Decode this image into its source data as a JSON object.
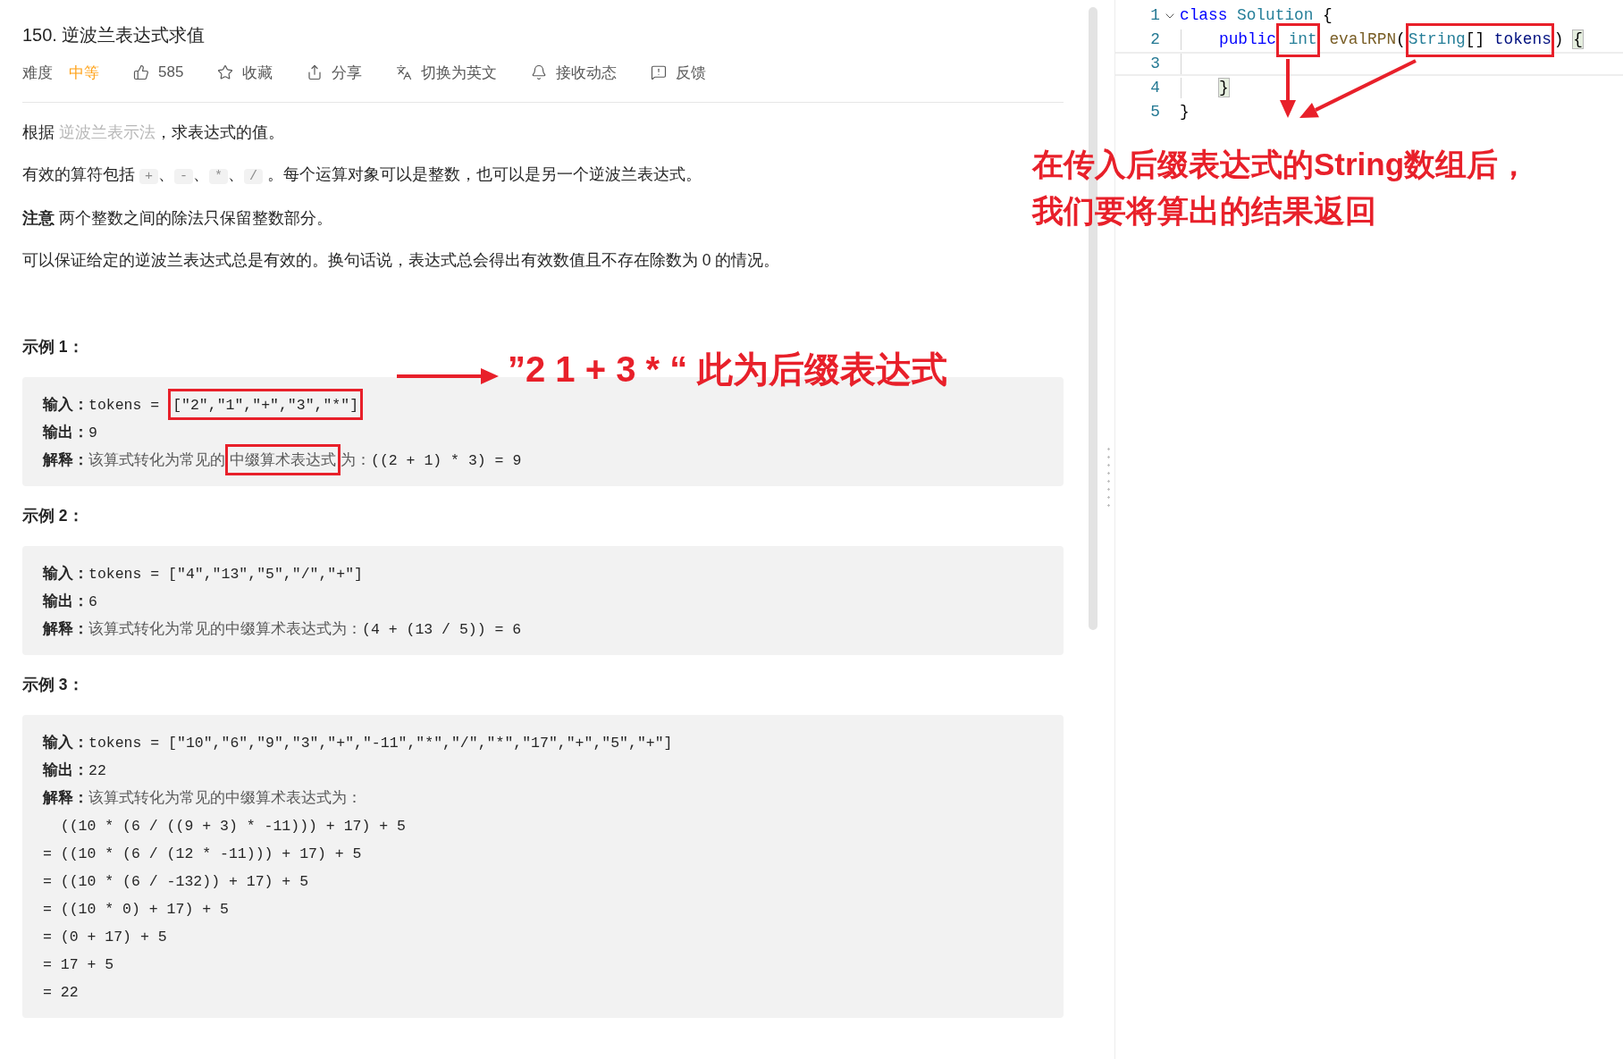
{
  "problem": {
    "title": "150. 逆波兰表达式求值",
    "meta": [
      {
        "kind": "difficulty",
        "label": "难度",
        "value": "中等"
      },
      {
        "kind": "like",
        "label": "585"
      },
      {
        "kind": "star",
        "label": "收藏"
      },
      {
        "kind": "share",
        "label": "分享"
      },
      {
        "kind": "translate",
        "label": "切换为英文"
      },
      {
        "kind": "bell",
        "label": "接收动态"
      },
      {
        "kind": "feedback",
        "label": "反馈"
      }
    ],
    "paragraphs": [
      [
        {
          "kind": "text",
          "text": "根据 "
        },
        {
          "kind": "link",
          "text": "逆波兰表示法"
        },
        {
          "kind": "text",
          "text": "，求表达式的值。"
        }
      ],
      [
        {
          "kind": "text",
          "text": "有效的算符包括 "
        },
        {
          "kind": "code",
          "text": "+"
        },
        {
          "kind": "text",
          "text": "、"
        },
        {
          "kind": "code",
          "text": "-"
        },
        {
          "kind": "text",
          "text": "、"
        },
        {
          "kind": "code",
          "text": "*"
        },
        {
          "kind": "text",
          "text": "、"
        },
        {
          "kind": "code",
          "text": "/"
        },
        {
          "kind": "text",
          "text": " 。每个运算对象可以是整数，也可以是另一个逆波兰表达式。"
        }
      ],
      [
        {
          "kind": "text",
          "text": "**注意** 两个整数之间的除法只保留整数部分。"
        }
      ],
      [
        {
          "kind": "text",
          "text": "可以保证给定的逆波兰表达式总是有效的。换句话说，表达式总会得出有效数值且不存在除数为 0 的情况。"
        }
      ]
    ],
    "examples": [
      {
        "heading": "示例 1：",
        "lines": [
          {
            "kind": "field",
            "label": "输入：",
            "parts": [
              {
                "kind": "code",
                "text": "tokens = "
              },
              {
                "kind": "code",
                "text": "[\"2\",\"1\",\"+\",\"3\",\"*\"]",
                "boxed": true
              }
            ]
          },
          {
            "kind": "field",
            "label": "输出：",
            "parts": [
              {
                "kind": "code",
                "text": "9"
              }
            ]
          },
          {
            "kind": "field",
            "label": "解释：",
            "parts": [
              {
                "kind": "note",
                "text": "该算式转化为常见的"
              },
              {
                "kind": "note",
                "text": "中缀算术表达式",
                "boxed": true
              },
              {
                "kind": "note",
                "text": "为："
              },
              {
                "kind": "code",
                "text": "((2 + 1) * 3) = 9"
              }
            ]
          }
        ]
      },
      {
        "heading": "示例 2：",
        "lines": [
          {
            "kind": "field",
            "label": "输入：",
            "parts": [
              {
                "kind": "code",
                "text": "tokens = [\"4\",\"13\",\"5\",\"/\",\"+\"]"
              }
            ]
          },
          {
            "kind": "field",
            "label": "输出：",
            "parts": [
              {
                "kind": "code",
                "text": "6"
              }
            ]
          },
          {
            "kind": "field",
            "label": "解释：",
            "parts": [
              {
                "kind": "note",
                "text": "该算式转化为常见的中缀算术表达式为："
              },
              {
                "kind": "code",
                "text": "(4 + (13 / 5)) = 6"
              }
            ]
          }
        ]
      },
      {
        "heading": "示例 3：",
        "lines": [
          {
            "kind": "field",
            "label": "输入：",
            "parts": [
              {
                "kind": "code",
                "text": "tokens = [\"10\",\"6\",\"9\",\"3\",\"+\",\"-11\",\"*\",\"/\",\"*\",\"17\",\"+\",\"5\",\"+\"]"
              }
            ]
          },
          {
            "kind": "field",
            "label": "输出：",
            "parts": [
              {
                "kind": "code",
                "text": "22"
              }
            ]
          },
          {
            "kind": "field",
            "label": "解释：",
            "parts": [
              {
                "kind": "note",
                "text": "该算式转化为常见的中缀算术表达式为："
              }
            ]
          },
          {
            "kind": "step",
            "parts": [
              {
                "kind": "code",
                "text": "  ((10 * (6 / ((9 + 3) * -11))) + 17) + 5"
              }
            ]
          },
          {
            "kind": "step",
            "parts": [
              {
                "kind": "code",
                "text": "= ((10 * (6 / (12 * -11))) + 17) + 5"
              }
            ]
          },
          {
            "kind": "step",
            "parts": [
              {
                "kind": "code",
                "text": "= ((10 * (6 / -132)) + 17) + 5"
              }
            ]
          },
          {
            "kind": "step",
            "parts": [
              {
                "kind": "code",
                "text": "= ((10 * 0) + 17) + 5"
              }
            ]
          },
          {
            "kind": "step",
            "parts": [
              {
                "kind": "code",
                "text": "= (0 + 17) + 5"
              }
            ]
          },
          {
            "kind": "step",
            "parts": [
              {
                "kind": "code",
                "text": "= 17 + 5"
              }
            ]
          },
          {
            "kind": "step",
            "parts": [
              {
                "kind": "code",
                "text": "= 22"
              }
            ]
          }
        ]
      }
    ]
  },
  "editor": {
    "lines": [
      {
        "number": "1",
        "fold_marker": true,
        "indented": false,
        "current": false,
        "segments": [
          {
            "text": "class",
            "kind": "keyword"
          },
          {
            "text": " Solution",
            "kind": "type"
          },
          {
            "text": " {",
            "kind": "plain"
          }
        ]
      },
      {
        "number": "2",
        "fold_marker": false,
        "indented": true,
        "current": false,
        "segments": [
          {
            "text": "public",
            "kind": "keyword"
          },
          {
            "kind": "group",
            "boxed": true,
            "parts": [
              {
                "text": " int",
                "kind": "type"
              }
            ]
          },
          {
            "text": " evalRPN",
            "kind": "function"
          },
          {
            "text": "(",
            "kind": "plain"
          },
          {
            "kind": "group",
            "boxed": true,
            "parts": [
              {
                "text": "String",
                "kind": "type"
              },
              {
                "text": "[] ",
                "kind": "plain"
              },
              {
                "text": "tokens",
                "kind": "param"
              }
            ]
          },
          {
            "text": ") ",
            "kind": "plain"
          },
          {
            "text": "{",
            "kind": "bracket"
          }
        ]
      },
      {
        "number": "3",
        "fold_marker": false,
        "indented": true,
        "current": true
      },
      {
        "number": "4",
        "fold_marker": false,
        "indented": true,
        "current": false,
        "segments": [
          {
            "text": "}",
            "kind": "bracket"
          }
        ]
      },
      {
        "number": "5",
        "fold_marker": false,
        "indented": false,
        "current": false,
        "segments": [
          {
            "text": "}",
            "kind": "plain"
          }
        ]
      }
    ]
  },
  "annotations": {
    "example_note": "”2 1 + 3 * “ 此为后缀表达式",
    "editor_note": [
      "在传入后缀表达式的String数组后，",
      "我们要将算出的结果返回"
    ]
  }
}
